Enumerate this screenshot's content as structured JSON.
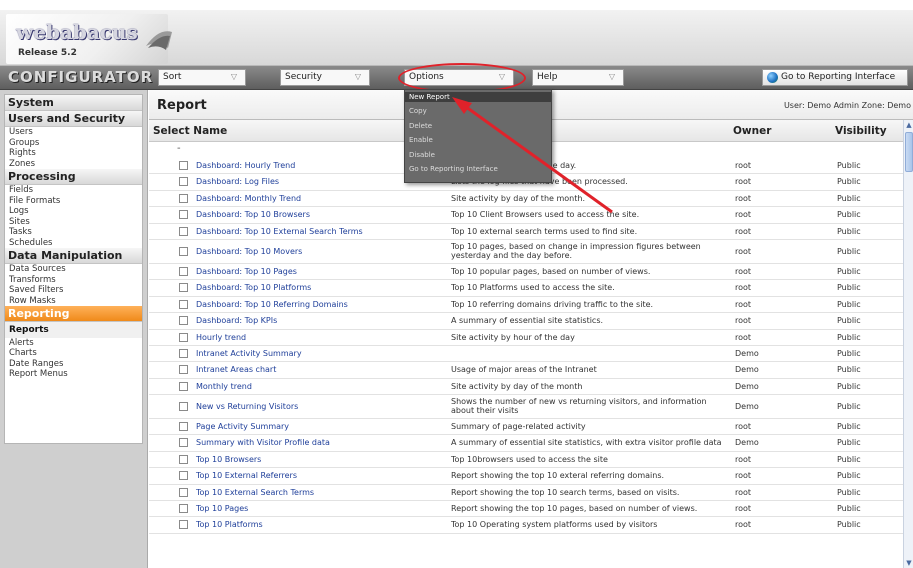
{
  "logo": {
    "name": "webabacus",
    "release": "Release 5.2"
  },
  "toolbar": {
    "title": "CONFIGURATOR",
    "sort_label": "Sort",
    "security_label": "Security",
    "options_label": "Options",
    "help_label": "Help",
    "reporting_button": "Go to Reporting Interface"
  },
  "sidebar": {
    "sections": [
      {
        "heading": "System",
        "items": []
      },
      {
        "heading": "Users and Security",
        "items": [
          "Users",
          "Groups",
          "Rights",
          "Zones"
        ]
      },
      {
        "heading": "Processing",
        "items": [
          "Fields",
          "File Formats",
          "Logs",
          "Sites",
          "Tasks",
          "Schedules"
        ]
      },
      {
        "heading": "Data Manipulation",
        "items": [
          "Data Sources",
          "Transforms",
          "Saved Filters",
          "Row Masks"
        ]
      },
      {
        "heading": "Reporting",
        "items": [
          "Reports",
          "Alerts",
          "Charts",
          "Date Ranges",
          "Report Menus"
        ]
      }
    ]
  },
  "main": {
    "title": "Report",
    "user_zone": "User: Demo Admin  Zone: Demo",
    "columns": {
      "select_name": "Select Name",
      "owner": "Owner",
      "visibility": "Visibility"
    },
    "dash": "-",
    "rows": [
      {
        "name": "Dashboard: Hourly Trend",
        "desc": "Site activity by hour of the day.",
        "owner": "root",
        "vis": "Public"
      },
      {
        "name": "Dashboard: Log Files",
        "desc": "Lists the log files that have been processed.",
        "owner": "root",
        "vis": "Public"
      },
      {
        "name": "Dashboard: Monthly Trend",
        "desc": "Site activity by day of the month.",
        "owner": "root",
        "vis": "Public"
      },
      {
        "name": "Dashboard: Top 10 Browsers",
        "desc": "Top 10 Client Browsers used to access the site.",
        "owner": "root",
        "vis": "Public"
      },
      {
        "name": "Dashboard: Top 10 External Search Terms",
        "desc": "Top 10 external search terms used to find site.",
        "owner": "root",
        "vis": "Public"
      },
      {
        "name": "Dashboard: Top 10 Movers",
        "desc": "Top 10 pages, based on change in impression figures between yesterday and the day before.",
        "owner": "root",
        "vis": "Public"
      },
      {
        "name": "Dashboard: Top 10 Pages",
        "desc": "Top 10 popular pages, based on number of views.",
        "owner": "root",
        "vis": "Public"
      },
      {
        "name": "Dashboard: Top 10 Platforms",
        "desc": "Top 10 Platforms used to access the site.",
        "owner": "root",
        "vis": "Public"
      },
      {
        "name": "Dashboard: Top 10 Referring Domains",
        "desc": "Top 10 referring domains driving traffic to the site.",
        "owner": "root",
        "vis": "Public"
      },
      {
        "name": "Dashboard: Top KPIs",
        "desc": "A summary of essential site statistics.",
        "owner": "root",
        "vis": "Public"
      },
      {
        "name": "Hourly trend",
        "desc": "Site activity by hour of the day",
        "owner": "root",
        "vis": "Public"
      },
      {
        "name": "Intranet Activity Summary",
        "desc": "",
        "owner": "Demo",
        "vis": "Public"
      },
      {
        "name": "Intranet Areas chart",
        "desc": "Usage of major areas of the Intranet",
        "owner": "Demo",
        "vis": "Public"
      },
      {
        "name": "Monthly trend",
        "desc": "Site activity by day of the month",
        "owner": "Demo",
        "vis": "Public"
      },
      {
        "name": "New vs Returning Visitors",
        "desc": "Shows the number of new vs returning visitors, and information about their visits",
        "owner": "Demo",
        "vis": "Public"
      },
      {
        "name": "Page Activity Summary",
        "desc": "Summary of page-related activity",
        "owner": "root",
        "vis": "Public"
      },
      {
        "name": "Summary with Visitor Profile data",
        "desc": "A summary of essential site statistics, with extra visitor profile data",
        "owner": "Demo",
        "vis": "Public"
      },
      {
        "name": "Top 10 Browsers",
        "desc": "Top 10browsers used to access the site",
        "owner": "root",
        "vis": "Public"
      },
      {
        "name": "Top 10 External Referrers",
        "desc": "Report showing the top 10 exteral referring domains.",
        "owner": "root",
        "vis": "Public"
      },
      {
        "name": "Top 10 External Search Terms",
        "desc": "Report showing the top 10 search terms, based on visits.",
        "owner": "root",
        "vis": "Public"
      },
      {
        "name": "Top 10 Pages",
        "desc": "Report showing the top 10 pages, based on number of views.",
        "owner": "root",
        "vis": "Public"
      },
      {
        "name": "Top 10 Platforms",
        "desc": "Top 10 Operating system platforms used by visitors",
        "owner": "root",
        "vis": "Public"
      }
    ]
  },
  "options_menu": {
    "items": [
      "New Report",
      "Copy",
      "Delete",
      "Enable",
      "Disable",
      "Go to Reporting Interface"
    ],
    "highlighted": "New Report"
  },
  "colors": {
    "accent_orange": "#f08a1a",
    "link_blue": "#1f3f9a",
    "highlight_red": "#e0222a"
  }
}
